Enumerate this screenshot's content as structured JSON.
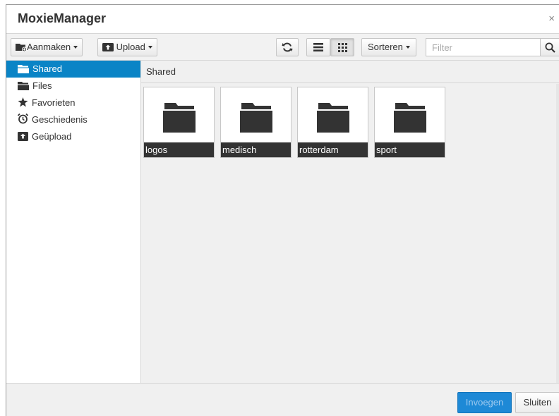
{
  "dialog": {
    "title": "MoxieManager",
    "close_glyph": "×"
  },
  "toolbar": {
    "create_label": "Aanmaken",
    "create_icon": "folder-add-icon",
    "upload_label": "Upload",
    "upload_icon": "upload-icon",
    "refresh_icon": "refresh-icon",
    "list_view_icon": "list-view-icon",
    "thumbnail_view_icon": "grid-view-icon",
    "active_view": "thumbnails",
    "sort_label": "Sorteren",
    "filter_placeholder": "Filter",
    "filter_value": "",
    "search_icon": "search-icon"
  },
  "sidebar": {
    "items": [
      {
        "label": "Shared",
        "icon": "folder-open-icon",
        "selected": true
      },
      {
        "label": "Files",
        "icon": "folder-icon",
        "selected": false
      },
      {
        "label": "Favorieten",
        "icon": "star-icon",
        "selected": false
      },
      {
        "label": "Geschiedenis",
        "icon": "alarm-clock-icon",
        "selected": false
      },
      {
        "label": "Geüpload",
        "icon": "upload-box-icon",
        "selected": false
      }
    ]
  },
  "main": {
    "path": "Shared",
    "folders": [
      {
        "name": "logos",
        "icon": "folder-icon"
      },
      {
        "name": "medisch",
        "icon": "folder-icon"
      },
      {
        "name": "rotterdam",
        "icon": "folder-icon"
      },
      {
        "name": "sport",
        "icon": "folder-icon"
      }
    ]
  },
  "footer": {
    "insert_label": "Invoegen",
    "close_label": "Sluiten"
  },
  "colors": {
    "accent": "#0a84c6",
    "insert_button": "#1e89d6",
    "tile_label_bg": "#333333"
  }
}
